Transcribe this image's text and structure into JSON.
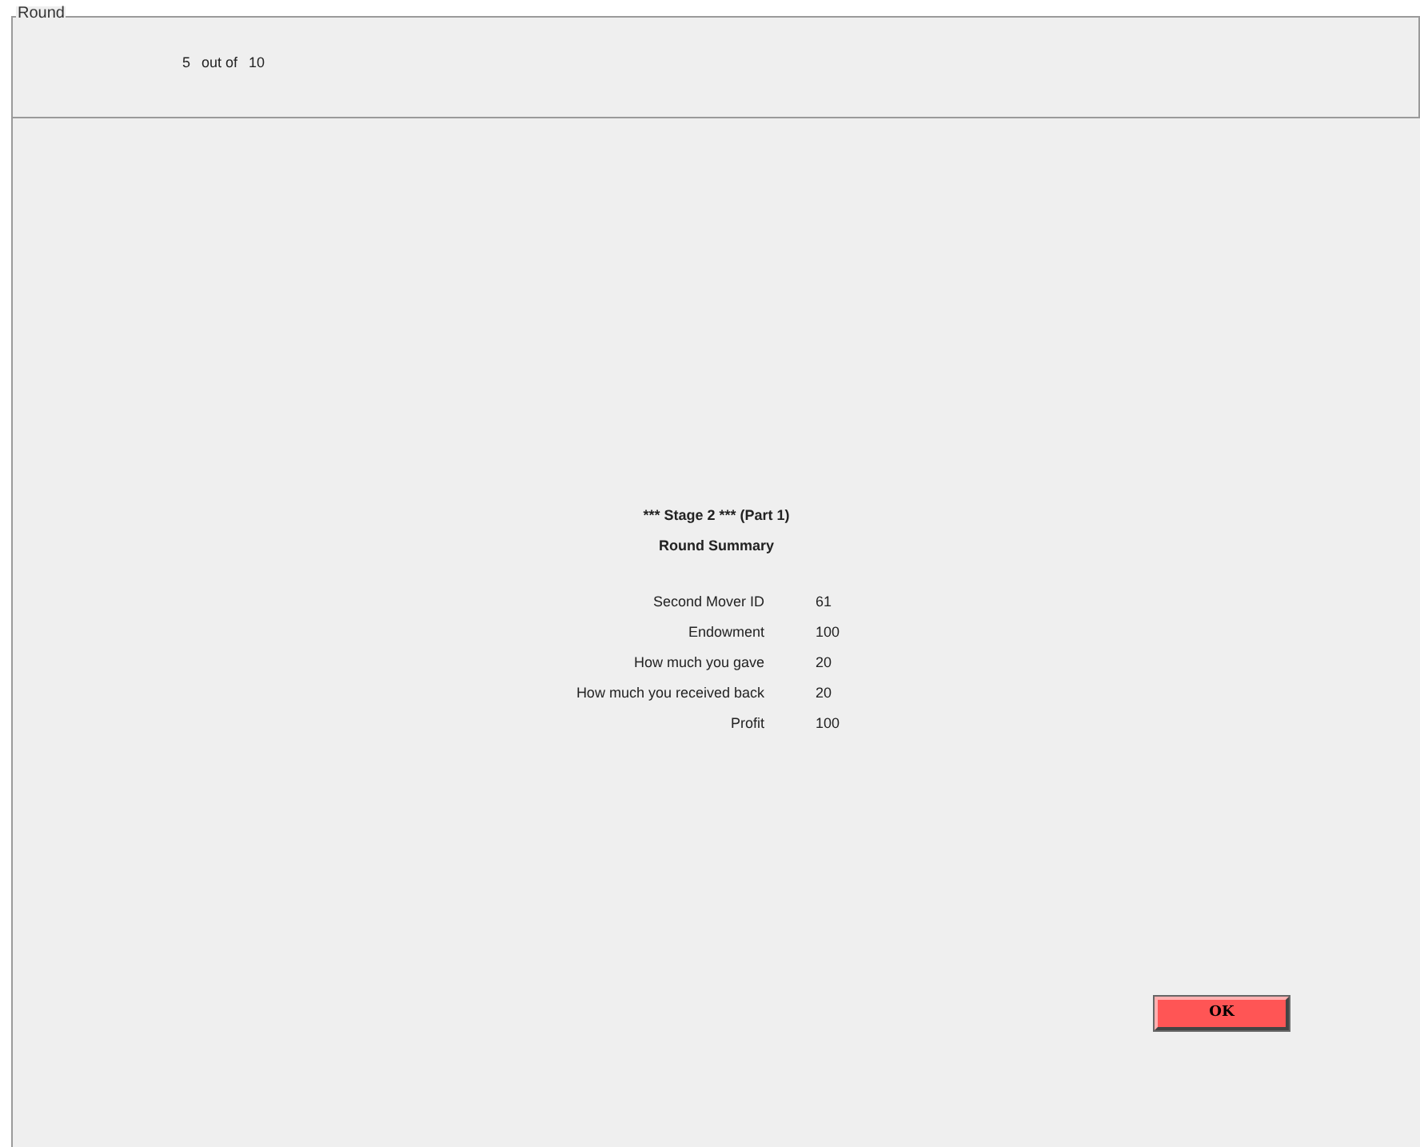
{
  "round_panel": {
    "title": "Round",
    "current": "5",
    "separator": "out of",
    "total": "10"
  },
  "summary": {
    "heading": "*** Stage 2 *** (Part 1)",
    "subheading": "Round Summary",
    "rows": [
      {
        "label": "Second Mover ID",
        "value": "61"
      },
      {
        "label": "Endowment",
        "value": "100"
      },
      {
        "label": "How much you gave",
        "value": "20"
      },
      {
        "label": "How much you received back",
        "value": "20"
      },
      {
        "label": "Profit",
        "value": "100"
      }
    ]
  },
  "ok_button": {
    "label": "OK"
  }
}
